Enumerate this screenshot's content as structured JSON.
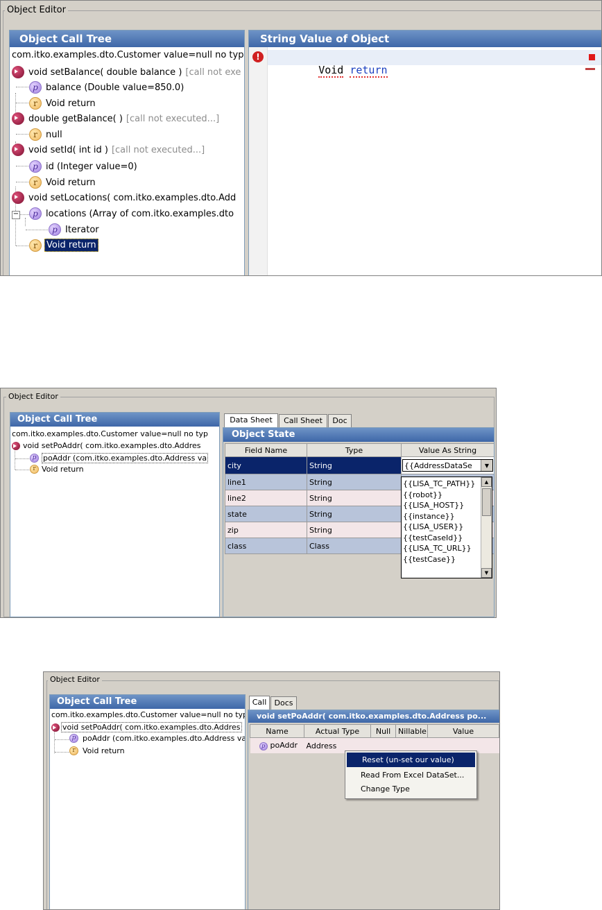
{
  "section1": {
    "legend": "Object Editor",
    "tree_title": "Object Call Tree",
    "value_title": "String Value of Object",
    "tree": [
      {
        "icon": "method-icon",
        "text": "com.itko.examples.dto.Customer value=null no typ",
        "gray": ""
      },
      {
        "icon": "method-icon",
        "text": "void setBalance( double balance )",
        "gray": "[call not exe"
      },
      {
        "icon": "param-icon",
        "text": "balance (Double value=850.0)",
        "gray": ""
      },
      {
        "icon": "return-icon",
        "text": "Void return",
        "gray": ""
      },
      {
        "icon": "method-icon",
        "text": "double getBalance( )",
        "gray": "[call not executed...]"
      },
      {
        "icon": "return-icon",
        "text": "null",
        "gray": ""
      },
      {
        "icon": "method-icon",
        "text": "void setId( int id )",
        "gray": "[call not executed...]"
      },
      {
        "icon": "param-icon",
        "text": "id (Integer value=0)",
        "gray": ""
      },
      {
        "icon": "return-icon",
        "text": "Void return",
        "gray": ""
      },
      {
        "icon": "method-icon",
        "text": "void setLocations( com.itko.examples.dto.Add",
        "gray": ""
      },
      {
        "icon": "param-icon",
        "text": "locations (Array of com.itko.examples.dto",
        "gray": ""
      },
      {
        "icon": "param-icon",
        "text": "Iterator",
        "gray": ""
      },
      {
        "icon": "return-icon",
        "text": "Void return",
        "gray": ""
      }
    ],
    "editor_keyword": "Void",
    "editor_word": "return"
  },
  "section2": {
    "legend": "Object Editor",
    "tree_title": "Object Call Tree",
    "tree": [
      {
        "text": "com.itko.examples.dto.Customer value=null no typ"
      },
      {
        "text": "void setPoAddr( com.itko.examples.dto.Addres"
      },
      {
        "text": "poAddr (com.itko.examples.dto.Address va"
      },
      {
        "text": "Void return"
      }
    ],
    "tabs": [
      "Data Sheet",
      "Call Sheet",
      "Doc"
    ],
    "state_title": "Object State",
    "columns": [
      "Field Name",
      "Type",
      "Value As String"
    ],
    "rows": [
      {
        "field": "city",
        "type": "String"
      },
      {
        "field": "line1",
        "type": "String"
      },
      {
        "field": "line2",
        "type": "String"
      },
      {
        "field": "state",
        "type": "String"
      },
      {
        "field": "zip",
        "type": "String"
      },
      {
        "field": "class",
        "type": "Class"
      }
    ],
    "combo_value": "{{AddressDataSe",
    "dropdown": [
      "{{LISA_TC_PATH}}",
      "{{robot}}",
      "{{LISA_HOST}}",
      "{{instance}}",
      "{{LISA_USER}}",
      "{{testCaseId}}",
      "{{LISA_TC_URL}}",
      "{{testCase}}"
    ]
  },
  "section3": {
    "legend": "Object Editor",
    "tree_title": "Object Call Tree",
    "tree": [
      {
        "text": "com.itko.examples.dto.Customer value=null no typ"
      },
      {
        "text": "void setPoAddr( com.itko.examples.dto.Addres"
      },
      {
        "text": "poAddr (com.itko.examples.dto.Address va"
      },
      {
        "text": "Void return"
      }
    ],
    "tabs": [
      "Call",
      "Docs"
    ],
    "call_title": "void setPoAddr( com.itko.examples.dto.Address po...",
    "columns": [
      "Name",
      "Actual Type",
      "Null",
      "Nillable",
      "Value"
    ],
    "row": {
      "name": "poAddr",
      "type": "Address"
    },
    "menu": [
      "Reset (un-set our value)",
      "Read From Excel DataSet...",
      "Change Type"
    ]
  }
}
